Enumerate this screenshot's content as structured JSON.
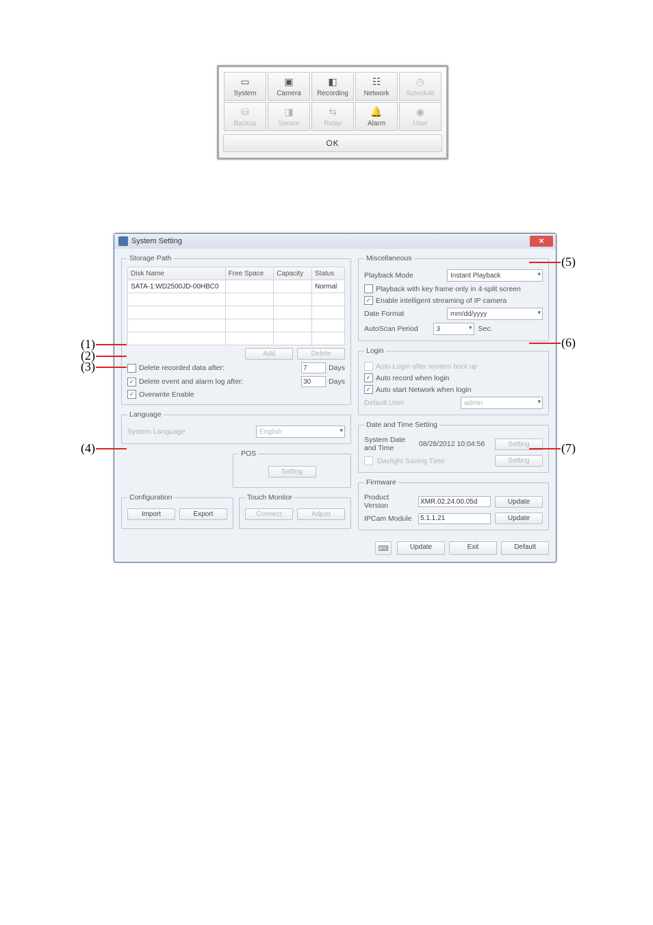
{
  "nav": {
    "row1": [
      {
        "label": "System",
        "state": "active"
      },
      {
        "label": "Camera",
        "state": "active"
      },
      {
        "label": "Recording",
        "state": "active"
      },
      {
        "label": "Network",
        "state": "active"
      },
      {
        "label": "Schedule",
        "state": "disabled"
      }
    ],
    "row2": [
      {
        "label": "Backup",
        "state": "disabled"
      },
      {
        "label": "Sensor",
        "state": "disabled"
      },
      {
        "label": "Relay",
        "state": "disabled"
      },
      {
        "label": "Alarm",
        "state": "active"
      },
      {
        "label": "User",
        "state": "disabled"
      }
    ],
    "ok": "OK"
  },
  "window": {
    "title": "System Setting"
  },
  "storage": {
    "legend": "Storage Path",
    "headers": [
      "Disk Name",
      "Free Space",
      "Capacity",
      "Status"
    ],
    "row": {
      "disk": "SATA-1:WD2500JD-00HBC0",
      "free": "",
      "capacity": "",
      "status": "Normal"
    },
    "add": "Add",
    "delete": "Delete",
    "opt1": {
      "label": "Delete recorded data after:",
      "value": "7",
      "unit": "Days",
      "checked": false
    },
    "opt2": {
      "label": "Delete event and alarm log after:",
      "value": "30",
      "unit": "Days",
      "checked": true
    },
    "opt3": {
      "label": "Overwrite Enable",
      "checked": true
    }
  },
  "language": {
    "legend": "Language",
    "label": "System Language",
    "value": "English"
  },
  "pos": {
    "legend": "POS",
    "setting": "Setting"
  },
  "config": {
    "legend": "Configuration",
    "import": "Import",
    "export": "Export"
  },
  "touch": {
    "legend": "Touch Monitor",
    "connect": "Connect",
    "adjust": "Adjust"
  },
  "misc": {
    "legend": "Miscellaneous",
    "playback_label": "Playback Mode",
    "playback_value": "Instant Playback",
    "keyframe": {
      "label": "Playback with key frame only in 4-split screen",
      "checked": false
    },
    "ipstream": {
      "label": "Enable intelligent streaming of IP camera",
      "checked": true
    },
    "dateformat_label": "Date Format",
    "dateformat_value": "mm/dd/yyyy",
    "autoscan_label": "AutoScan Period",
    "autoscan_value": "3",
    "autoscan_unit": "Sec."
  },
  "login": {
    "legend": "Login",
    "auto_login": {
      "label": "Auto Login after system boot up",
      "checked": false
    },
    "auto_record": {
      "label": "Auto record when login",
      "checked": true
    },
    "auto_network": {
      "label": "Auto start Network when login",
      "checked": true
    },
    "default_user_label": "Default User",
    "default_user_value": "admin"
  },
  "datetime": {
    "legend": "Date and Time Setting",
    "sys_label": "System Date and Time",
    "sys_value": "08/28/2012 10:04:56",
    "sys_btn": "Setting",
    "dst_label": "Daylight Saving Time",
    "dst_btn": "Setting"
  },
  "firmware": {
    "legend": "Firmware",
    "product_label": "Product Version",
    "product_value": "XMR.02.24.00.05d",
    "product_btn": "Update",
    "ipcam_label": "IPCam Module",
    "ipcam_value": "5.1.1.21",
    "ipcam_btn": "Update"
  },
  "footer": {
    "update": "Update",
    "exit": "Exit",
    "default": "Default"
  },
  "callouts": {
    "c1": "(1)",
    "c2": "(2)",
    "c3": "(3)",
    "c4": "(4)",
    "c5": "(5)",
    "c6": "(6)",
    "c7": "(7)"
  }
}
